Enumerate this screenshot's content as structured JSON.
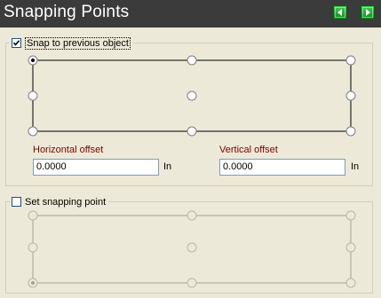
{
  "window": {
    "title": "Snapping Points"
  },
  "nav": {
    "back_icon": "arrow-left-icon",
    "forward_icon": "arrow-right-icon",
    "accent_color": "#16a02a"
  },
  "snap_previous": {
    "label": "Snap to previous object",
    "checked": true,
    "selected_point": "top-left",
    "horizontal_offset": {
      "label": "Horizontal offset",
      "value": "0.0000",
      "unit": "In"
    },
    "vertical_offset": {
      "label": "Vertical offset",
      "value": "0.0000",
      "unit": "In"
    }
  },
  "set_snapping": {
    "label": "Set snapping point",
    "checked": false,
    "selected_point": "bottom-left",
    "enabled": false
  },
  "colors": {
    "titlebar_bg": "#3b3b3b",
    "panel_bg": "#ece9d8",
    "field_label": "#800000"
  }
}
